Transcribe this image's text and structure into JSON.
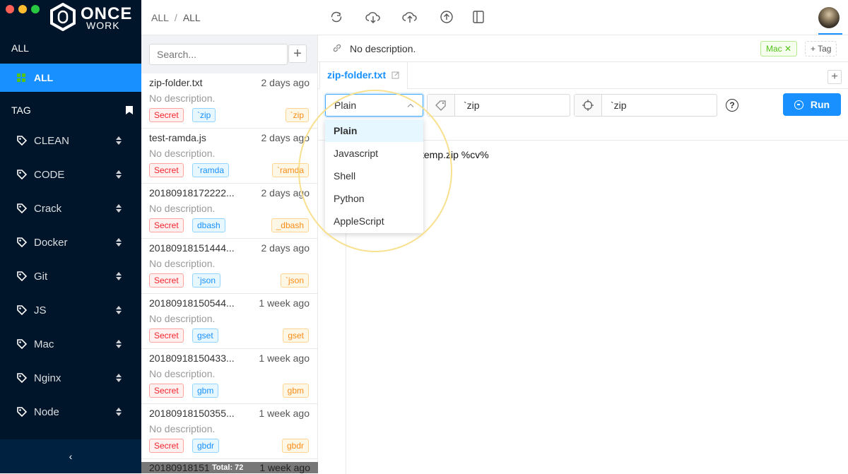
{
  "window": {
    "controls": [
      "close",
      "minimize",
      "maximize"
    ]
  },
  "logo": {
    "line1": "ONCE",
    "line2": "WORK",
    "hex_glyph": "0"
  },
  "sidebar": {
    "all_header": "ALL",
    "all_item": {
      "label": "ALL",
      "icon": "grid-icon"
    },
    "tag_header": {
      "label": "TAG",
      "icon": "bookmark-icon"
    },
    "tags": [
      {
        "label": "CLEAN"
      },
      {
        "label": "CODE"
      },
      {
        "label": "Crack"
      },
      {
        "label": "Docker"
      },
      {
        "label": "Git"
      },
      {
        "label": "JS"
      },
      {
        "label": "Mac"
      },
      {
        "label": "Nginx"
      },
      {
        "label": "Node"
      }
    ],
    "collapse_glyph": "‹"
  },
  "topbar": {
    "breadcrumb": [
      "ALL",
      "/",
      "ALL"
    ],
    "icons": [
      "sync-icon",
      "cloud-download-icon",
      "cloud-upload-icon",
      "upload-circle-icon",
      "book-icon"
    ]
  },
  "list": {
    "search_placeholder": "Search...",
    "add_label": "+",
    "items": [
      {
        "name": "zip-folder.txt",
        "date": "2 days ago",
        "desc": "No description.",
        "secret": "Secret",
        "tag": "`zip",
        "lang": "`zip"
      },
      {
        "name": "test-ramda.js",
        "date": "2 days ago",
        "desc": "No description.",
        "secret": "Secret",
        "tag": "`ramda",
        "lang": "`ramda"
      },
      {
        "name": "20180918172222...",
        "date": "2 days ago",
        "desc": "No description.",
        "secret": "Secret",
        "tag": "dbash",
        "lang": "_dbash"
      },
      {
        "name": "20180918151444...",
        "date": "2 days ago",
        "desc": "No description.",
        "secret": "Secret",
        "tag": "`json",
        "lang": "`json"
      },
      {
        "name": "20180918150544...",
        "date": "1 week ago",
        "desc": "No description.",
        "secret": "Secret",
        "tag": "gset",
        "lang": "gset"
      },
      {
        "name": "20180918150433...",
        "date": "1 week ago",
        "desc": "No description.",
        "secret": "Secret",
        "tag": "gbm",
        "lang": "gbm"
      },
      {
        "name": "20180918150355...",
        "date": "1 week ago",
        "desc": "No description.",
        "secret": "Secret",
        "tag": "gbdr",
        "lang": "gbdr"
      }
    ],
    "last_row": {
      "name": "20180918151",
      "date": "1 week ago"
    },
    "total": "Total: 72"
  },
  "content": {
    "description": "No description.",
    "tags": {
      "mac": "Mac ✕",
      "add": "+ Tag"
    },
    "file_tab": "zip-folder.txt",
    "tab_add": "+",
    "language": "Plain",
    "args_value": "`zip",
    "cwd_value": "`zip",
    "help": "?",
    "run_label": "Run",
    "code_line": "temp.zip %cv%"
  },
  "dropdown": {
    "options": [
      "Plain",
      "Javascript",
      "Shell",
      "Python",
      "AppleScript"
    ],
    "selected": "Plain"
  },
  "colors": {
    "sidebar_bg": "#001529",
    "accent": "#1890ff",
    "highlight": "#f8e08e"
  }
}
